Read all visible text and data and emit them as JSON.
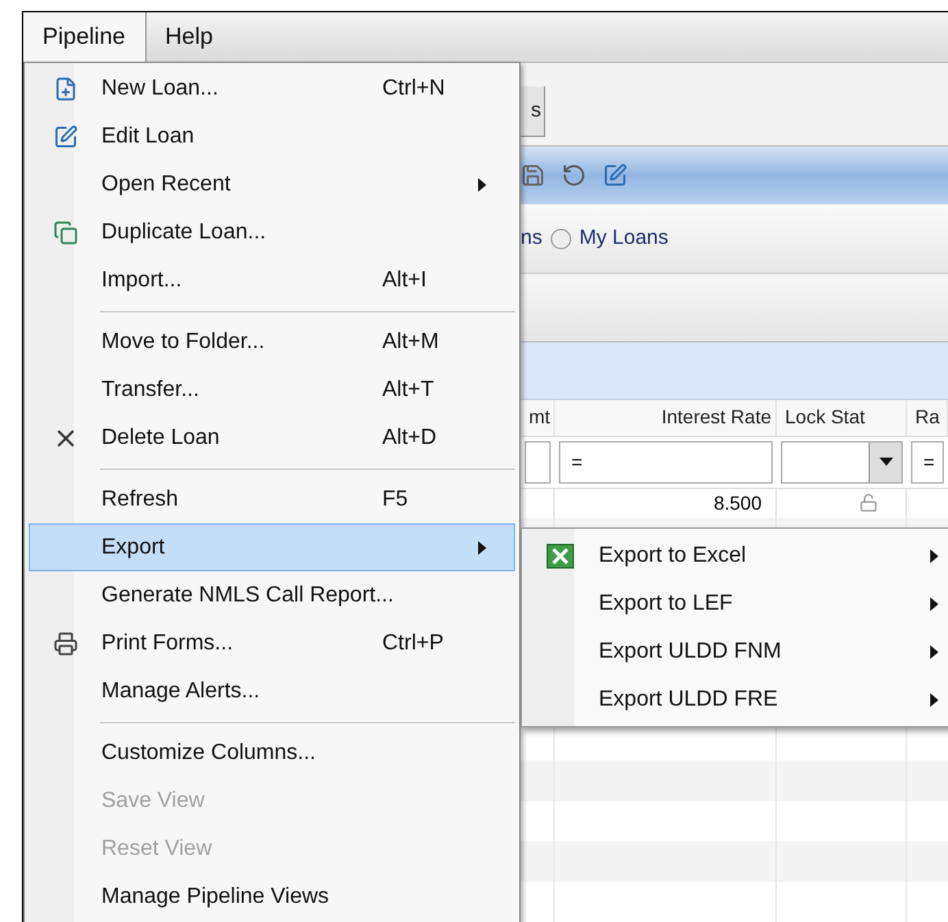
{
  "menubar": [
    {
      "label": "Pipeline",
      "selected": true
    },
    {
      "label": "Help",
      "selected": false
    }
  ],
  "menu": {
    "items": [
      {
        "kind": "item",
        "label": "New Loan...",
        "shortcut": "Ctrl+N",
        "submenu": false,
        "selected": false,
        "disabled": false
      },
      {
        "kind": "item",
        "label": "Edit Loan",
        "submenu": false,
        "selected": false,
        "disabled": false
      },
      {
        "kind": "item",
        "label": "Open Recent",
        "submenu": true,
        "selected": false,
        "disabled": false
      },
      {
        "kind": "item",
        "label": "Duplicate Loan...",
        "submenu": false,
        "selected": false,
        "disabled": false
      },
      {
        "kind": "item",
        "label": "Import...",
        "shortcut": "Alt+I",
        "submenu": false,
        "selected": false,
        "disabled": false
      },
      {
        "kind": "separator"
      },
      {
        "kind": "item",
        "label": "Move to Folder...",
        "shortcut": "Alt+M",
        "submenu": false,
        "selected": false,
        "disabled": false
      },
      {
        "kind": "item",
        "label": "Transfer...",
        "shortcut": "Alt+T",
        "submenu": false,
        "selected": false,
        "disabled": false
      },
      {
        "kind": "item",
        "label": "Delete Loan",
        "shortcut": "Alt+D",
        "submenu": false,
        "selected": false,
        "disabled": false
      },
      {
        "kind": "separator"
      },
      {
        "kind": "item",
        "label": "Refresh",
        "shortcut": "F5",
        "submenu": false,
        "selected": false,
        "disabled": false
      },
      {
        "kind": "item",
        "label": "Export",
        "submenu": true,
        "selected": true,
        "disabled": false
      },
      {
        "kind": "item",
        "label": "Generate NMLS Call Report...",
        "submenu": false,
        "selected": false,
        "disabled": false
      },
      {
        "kind": "item",
        "label": "Print Forms...",
        "shortcut": "Ctrl+P",
        "submenu": false,
        "selected": false,
        "disabled": false
      },
      {
        "kind": "item",
        "label": "Manage Alerts...",
        "submenu": false,
        "selected": false,
        "disabled": false
      },
      {
        "kind": "separator"
      },
      {
        "kind": "item",
        "label": "Customize Columns...",
        "submenu": false,
        "selected": false,
        "disabled": false
      },
      {
        "kind": "item",
        "label": "Save View",
        "submenu": false,
        "selected": false,
        "disabled": true
      },
      {
        "kind": "item",
        "label": "Reset View",
        "submenu": false,
        "selected": false,
        "disabled": true
      },
      {
        "kind": "item",
        "label": "Manage Pipeline Views",
        "submenu": false,
        "selected": false,
        "disabled": false
      }
    ]
  },
  "submenu": {
    "items": [
      {
        "label": "Export to Excel",
        "submenu": true
      },
      {
        "label": "Export to LEF",
        "submenu": true
      },
      {
        "label": "Export ULDD FNM",
        "submenu": true
      },
      {
        "label": "Export ULDD FRE",
        "submenu": true
      }
    ]
  },
  "background": {
    "tab": "s",
    "scope_partial": "ns",
    "scope_radio": {
      "label": "My Loans",
      "selected": false
    },
    "grid": {
      "columns": [
        "mt",
        "Interest Rate",
        "Lock Stat",
        "Ra"
      ],
      "filters": [
        {
          "kind": "text"
        },
        {
          "kind": "text",
          "value": "="
        },
        {
          "kind": "dropdown"
        },
        {
          "kind": "text",
          "value": "="
        }
      ],
      "rows": [
        {
          "interest_rate": "8.500",
          "locked": false
        }
      ]
    }
  }
}
